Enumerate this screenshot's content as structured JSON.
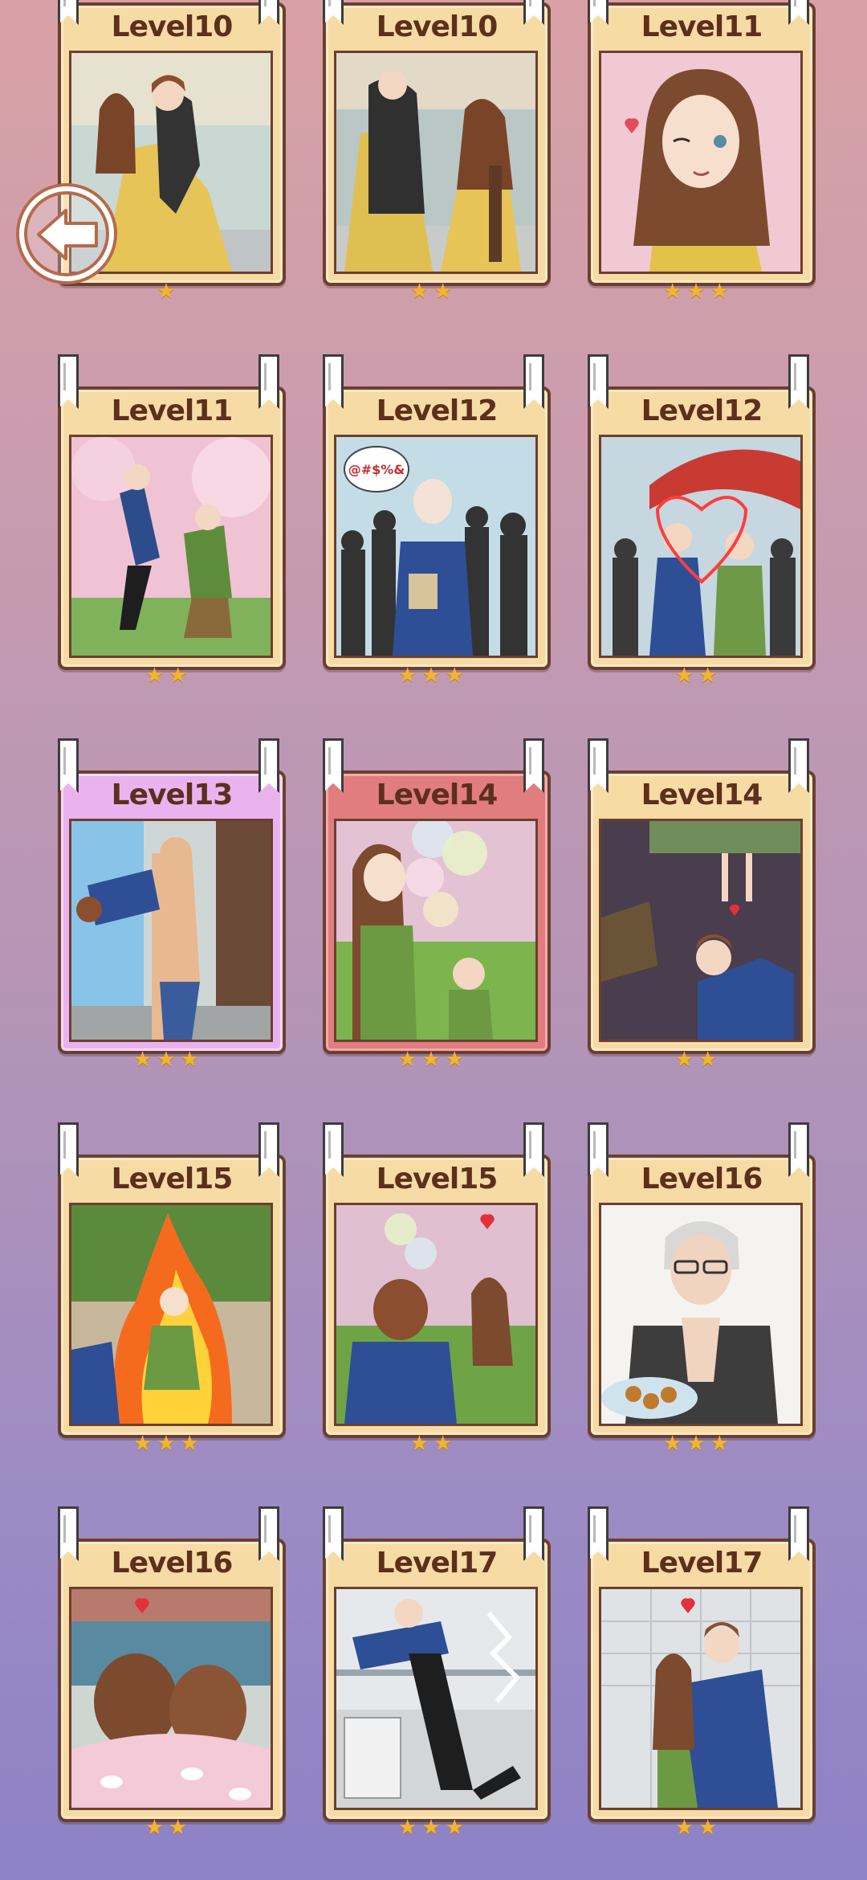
{
  "levels": [
    {
      "label": "Level10",
      "stars": "★",
      "theme": "gold",
      "art": "dance"
    },
    {
      "label": "Level10",
      "stars": "★★",
      "theme": "gold",
      "art": "dance2"
    },
    {
      "label": "Level11",
      "stars": "★★★",
      "theme": "gold",
      "art": "wink"
    },
    {
      "label": "Level11",
      "stars": "★★",
      "theme": "gold",
      "art": "sakura"
    },
    {
      "label": "Level12",
      "stars": "★★★",
      "theme": "gold",
      "art": "bald"
    },
    {
      "label": "Level12",
      "stars": "★★",
      "theme": "gold",
      "art": "umbrella"
    },
    {
      "label": "Level13",
      "stars": "★★★",
      "theme": "pink",
      "art": "muscle"
    },
    {
      "label": "Level14",
      "stars": "★★★",
      "theme": "red",
      "art": "balloons"
    },
    {
      "label": "Level14",
      "stars": "★★",
      "theme": "gold",
      "art": "kneel"
    },
    {
      "label": "Level15",
      "stars": "★★★",
      "theme": "gold",
      "art": "fire"
    },
    {
      "label": "Level15",
      "stars": "★★",
      "theme": "gold",
      "art": "park"
    },
    {
      "label": "Level16",
      "stars": "★★★",
      "theme": "gold",
      "art": "colonel"
    },
    {
      "label": "Level16",
      "stars": "★★",
      "theme": "gold",
      "art": "backs"
    },
    {
      "label": "Level17",
      "stars": "★★★",
      "theme": "gold",
      "art": "kitchen"
    },
    {
      "label": "Level17",
      "stars": "★★",
      "theme": "gold",
      "art": "hug"
    }
  ],
  "back_button": {
    "icon": "back-arrow-icon"
  },
  "speech_bubble": {
    "text": "@#$%&"
  },
  "colors": {
    "star": "#f2b52e",
    "title": "#5c2f1e",
    "card_gold": "#f7dba5",
    "card_pink": "#eab3ef",
    "card_red": "#e27d7f"
  }
}
